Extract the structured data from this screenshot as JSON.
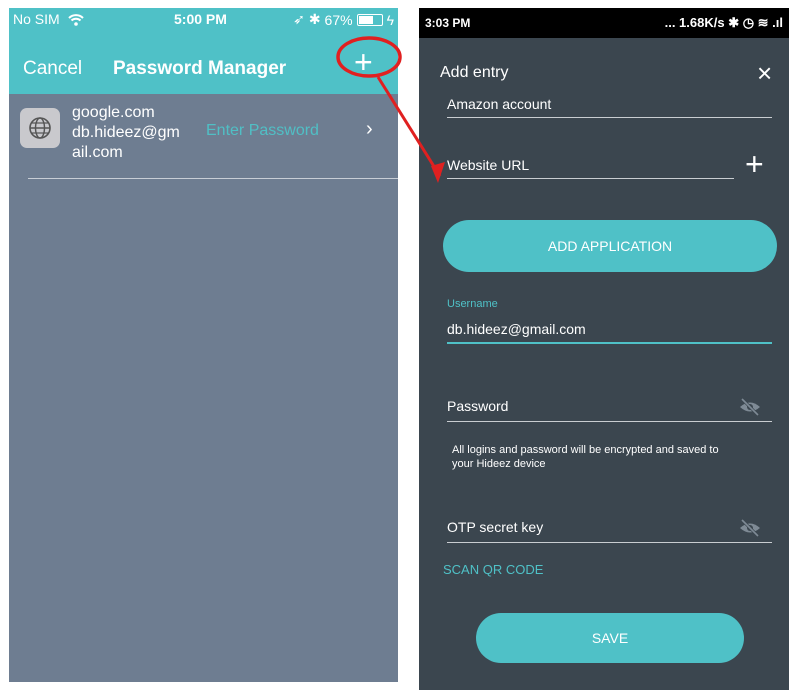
{
  "left_phone": {
    "statusbar": {
      "carrier": "No SIM",
      "time": "5:00 PM",
      "battery_label": "67%",
      "battery_fill": 0.67
    },
    "navbar": {
      "cancel_label": "Cancel",
      "title": "Password Manager",
      "add_label": "+"
    },
    "entry": {
      "domain": "google.com",
      "account": "db.hideez@gmail.com",
      "action_label": "Enter Password",
      "chevron": "›"
    },
    "colors": {
      "nav_bg": "#4fc1c7",
      "body_bg": "#6e7d91",
      "accent": "#50bfc5",
      "annotation": "#e02020"
    }
  },
  "right_phone": {
    "statusbar": {
      "time": "3:03 PM",
      "indicators": "... 1.68K/s ✱ ◷ ≋ .ıl"
    },
    "header": {
      "title": "Add entry",
      "close_label": "×"
    },
    "fields": {
      "name_value": "Amazon account",
      "url_value": "Website URL",
      "add_url_label": "+",
      "username_label": "Username",
      "username_value": "db.hideez@gmail.com",
      "password_value": "Password",
      "otp_value": "OTP secret key"
    },
    "add_application_label": "ADD APPLICATION",
    "note": "All logins and password will be encrypted and saved to your Hideez device",
    "scan_label": "SCAN QR CODE",
    "save_label": "SAVE",
    "icons": [
      "eye-off-icon",
      "eye-off-icon"
    ],
    "colors": {
      "bg": "#3b464f",
      "accent": "#4fc1c7",
      "line": "#c9cdd1"
    }
  }
}
